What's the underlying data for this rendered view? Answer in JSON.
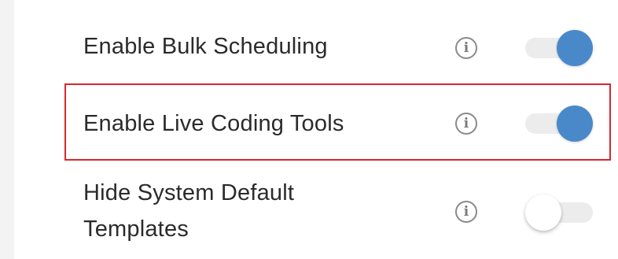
{
  "settings": {
    "items": [
      {
        "label": "Enable Bulk Scheduling",
        "info_icon": "info-icon",
        "enabled": true
      },
      {
        "label": "Enable Live Coding Tools",
        "info_icon": "info-icon",
        "enabled": true,
        "highlighted": true
      },
      {
        "label": "Hide System Default Templates",
        "info_icon": "info-icon",
        "enabled": false
      }
    ],
    "info_glyph": "i"
  },
  "colors": {
    "toggle_on": "#4a89c9",
    "toggle_off_knob": "#ffffff",
    "track": "#ececec",
    "highlight_border": "#d9262c",
    "label_text": "#2b2b2b"
  }
}
